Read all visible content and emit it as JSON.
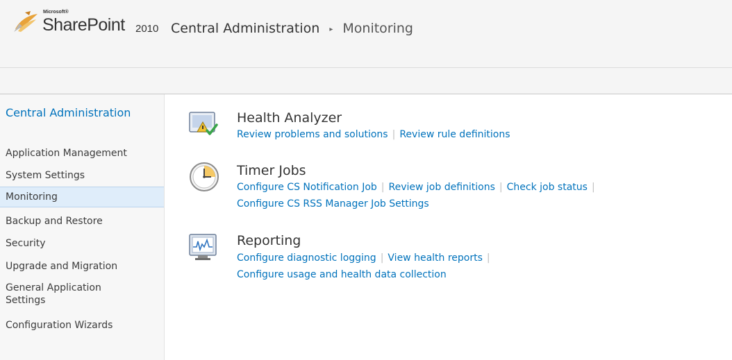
{
  "brand": {
    "microsoft": "Microsoft®",
    "product": "SharePoint",
    "version": "2010"
  },
  "breadcrumb": {
    "root": "Central Administration",
    "separator": "▸",
    "current": "Monitoring"
  },
  "leftnav": {
    "header": "Central Administration",
    "items": [
      {
        "label": "Application Management"
      },
      {
        "label": "System Settings"
      },
      {
        "label": "Monitoring",
        "selected": true
      },
      {
        "label": "Backup and Restore"
      },
      {
        "label": "Security"
      },
      {
        "label": "Upgrade and Migration"
      },
      {
        "label": "General Application Settings"
      },
      {
        "label": "Configuration Wizards"
      }
    ]
  },
  "sections": [
    {
      "title": "Health Analyzer",
      "icon": "health-analyzer-icon",
      "links": [
        "Review problems and solutions",
        "Review rule definitions"
      ]
    },
    {
      "title": "Timer Jobs",
      "icon": "clock-icon",
      "links": [
        "Configure CS Notification Job",
        "Review job definitions",
        "Check job status",
        "Configure CS RSS Manager Job Settings"
      ]
    },
    {
      "title": "Reporting",
      "icon": "monitor-chart-icon",
      "links": [
        "Configure diagnostic logging",
        "View health reports",
        "Configure usage and health data collection"
      ]
    }
  ],
  "colors": {
    "link": "#0072bc",
    "selected_nav_bg": "#dfedfa",
    "header_bg": "#f5f5f5"
  }
}
